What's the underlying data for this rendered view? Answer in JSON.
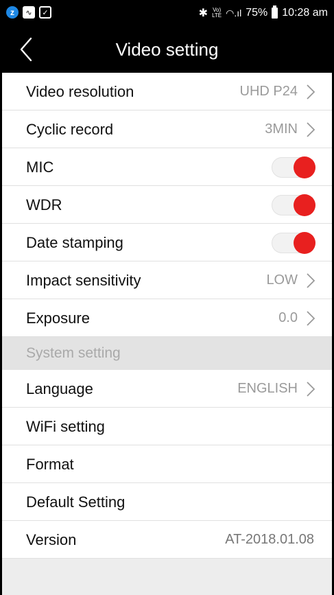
{
  "status_bar": {
    "left_icons": [
      "z-app-icon",
      "wave-app-icon",
      "checkbox-icon"
    ],
    "volte_label": "Vo)\nLTE",
    "battery_percent": "75%",
    "time": "10:28 am"
  },
  "nav": {
    "title": "Video setting",
    "back_icon": "chevron-left-icon"
  },
  "colors": {
    "toggle_on": "#e8201f",
    "nav_bg": "#000000",
    "section_bg": "#e3e3e3"
  },
  "video_settings": [
    {
      "label": "Video resolution",
      "value": "UHD P24"
    },
    {
      "label": "Cyclic record",
      "value": "3MIN"
    },
    {
      "label": "MIC",
      "toggle": true
    },
    {
      "label": "WDR",
      "toggle": true
    },
    {
      "label": "Date stamping",
      "toggle": true
    },
    {
      "label": "Impact sensitivity",
      "value": "LOW"
    },
    {
      "label": "Exposure",
      "value": "0.0"
    }
  ],
  "system_section": {
    "header": "System setting",
    "items": [
      {
        "label": "Language",
        "value": "ENGLISH"
      },
      {
        "label": "WiFi setting"
      },
      {
        "label": "Format"
      },
      {
        "label": "Default Setting"
      },
      {
        "label": "Version",
        "value": "AT-2018.01.08"
      }
    ]
  }
}
